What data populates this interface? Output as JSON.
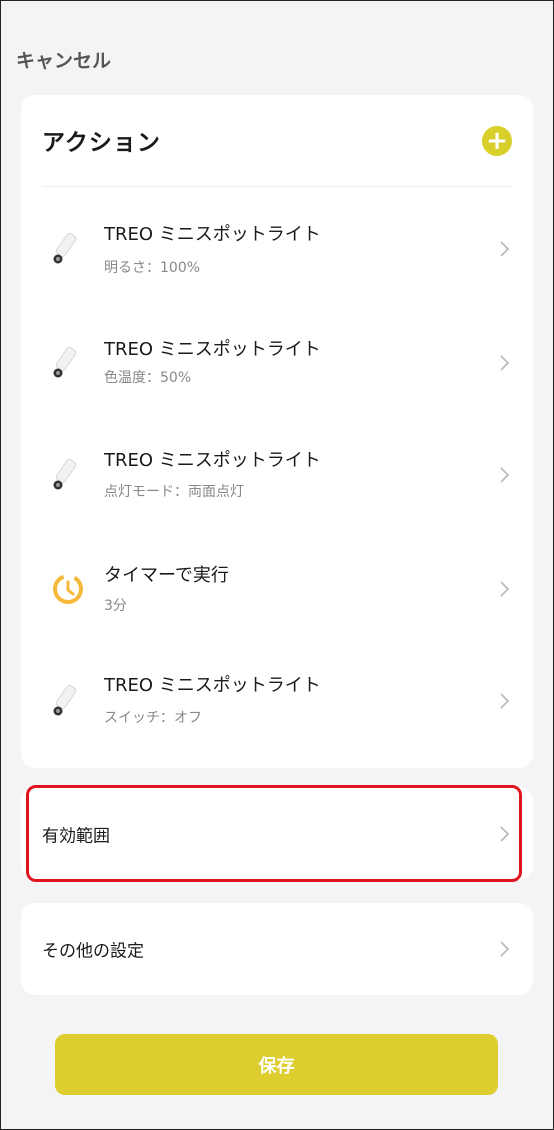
{
  "header": {
    "cancel_label": "キャンセル"
  },
  "actions": {
    "title": "アクション",
    "add_icon": "plus-circle-icon",
    "accent_color": "#d9cf2a",
    "items": [
      {
        "icon": "spotlight-icon",
        "title": "TREO ミニスポットライト",
        "subtitle": "明るさ：100%"
      },
      {
        "icon": "spotlight-icon",
        "title": "TREO ミニスポットライト",
        "subtitle": "色温度：50%"
      },
      {
        "icon": "spotlight-icon",
        "title": "TREO ミニスポットライト",
        "subtitle": "点灯モード：両面点灯"
      },
      {
        "icon": "timer-icon",
        "title": "タイマーで実行",
        "subtitle": "3分"
      },
      {
        "icon": "spotlight-icon",
        "title": "TREO ミニスポットライト",
        "subtitle": "スイッチ：オフ"
      }
    ]
  },
  "scope": {
    "label": "有効範囲",
    "highlight_color": "#e0141e"
  },
  "other_settings": {
    "label": "その他の設定"
  },
  "footer": {
    "save_label": "保存",
    "button_color": "#ddcd2e"
  }
}
